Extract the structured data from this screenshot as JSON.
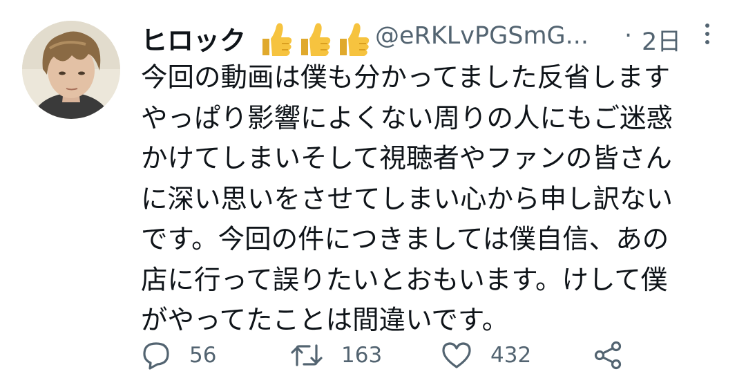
{
  "tweet": {
    "display_name": "ヒロック",
    "badges": [
      "thumbs-up-emoji",
      "thumbs-up-emoji",
      "thumbs-up-emoji"
    ],
    "handle": "@eRKLvPGSmG...",
    "separator": "·",
    "time": "2日",
    "body_lines": [
      "今回の動画は僕も分かってました反省します",
      "やっぱり影響によくない周りの人にもご迷惑",
      "かけてしまいそして視聴者やファンの皆さん",
      "に深い思いをさせてしまい心から申し訳ない",
      "です。今回の件につきましては僕自信、あの",
      "店に行って誤りたいとおもいます。けして僕",
      "がやってたことは間違いです。"
    ],
    "actions": {
      "reply_count": "56",
      "retweet_count": "163",
      "like_count": "432"
    }
  },
  "icons": {
    "reply": "speech-bubble-icon",
    "retweet": "retweet-arrows-icon",
    "like": "heart-icon",
    "share": "share-icon",
    "more": "vertical-dots-icon"
  },
  "colors": {
    "text": "#0f1419",
    "secondary": "#536471",
    "emoji": "#f6c33f"
  }
}
